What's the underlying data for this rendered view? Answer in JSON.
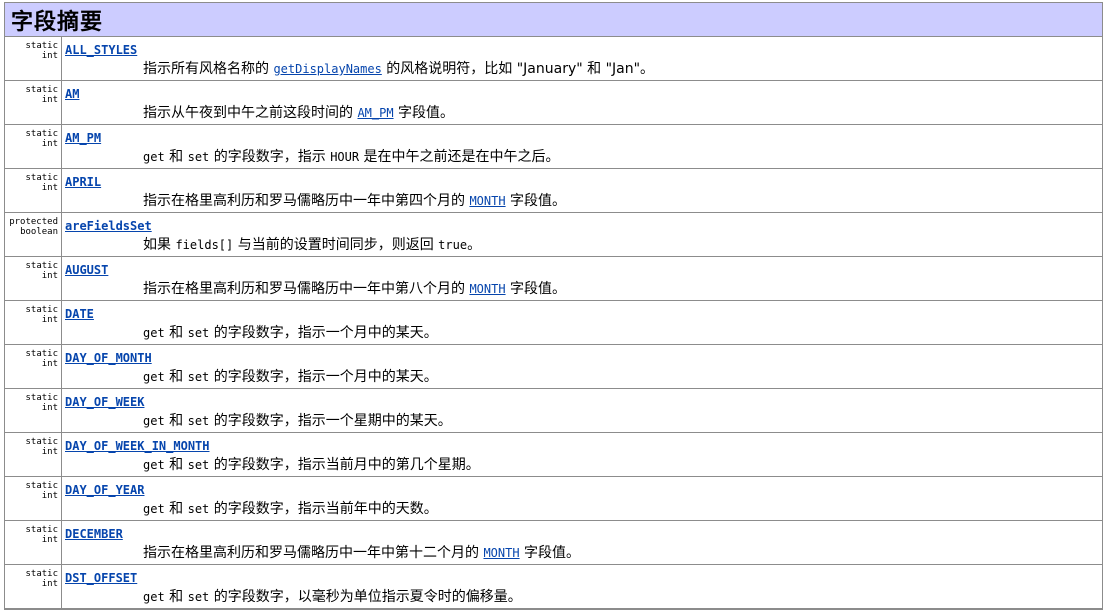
{
  "header": {
    "title": "字段摘要"
  },
  "rows": [
    {
      "modifier": "static int",
      "name": "ALL_STYLES",
      "d1": "指示所有风格名称的 ",
      "d_link": "getDisplayNames",
      "d2": " 的风格说明符，比如 \"January\" 和 \"Jan\"。"
    },
    {
      "modifier": "static int",
      "name": "AM",
      "d1": "指示从午夜到中午之前这段时间的 ",
      "d_link": "AM_PM",
      "d2": " 字段值。"
    },
    {
      "modifier": "static int",
      "name": "AM_PM",
      "c1": "get",
      "t1": " 和 ",
      "c2": "set",
      "t2": " 的字段数字，指示 ",
      "c3": "HOUR",
      "t3": " 是在中午之前还是在中午之后。"
    },
    {
      "modifier": "static int",
      "name": "APRIL",
      "d1": "指示在格里高利历和罗马儒略历中一年中第四个月的 ",
      "d_link": "MONTH",
      "d2": " 字段值。"
    },
    {
      "modifier1": "protected",
      "modifier2": "boolean",
      "name": "areFieldsSet",
      "t1": "如果 ",
      "c1": "fields[]",
      "t2": " 与当前的设置时间同步，则返回 ",
      "c2": "true",
      "t3": "。"
    },
    {
      "modifier": "static int",
      "name": "AUGUST",
      "d1": "指示在格里高利历和罗马儒略历中一年中第八个月的 ",
      "d_link": "MONTH",
      "d2": " 字段值。"
    },
    {
      "modifier": "static int",
      "name": "DATE",
      "c1": "get",
      "t1": " 和 ",
      "c2": "set",
      "t2": " 的字段数字，指示一个月中的某天。"
    },
    {
      "modifier": "static int",
      "name": "DAY_OF_MONTH",
      "c1": "get",
      "t1": " 和 ",
      "c2": "set",
      "t2": " 的字段数字，指示一个月中的某天。"
    },
    {
      "modifier": "static int",
      "name": "DAY_OF_WEEK",
      "c1": "get",
      "t1": " 和 ",
      "c2": "set",
      "t2": " 的字段数字，指示一个星期中的某天。"
    },
    {
      "modifier": "static int",
      "name": "DAY_OF_WEEK_IN_MONTH",
      "c1": "get",
      "t1": " 和 ",
      "c2": "set",
      "t2": " 的字段数字，指示当前月中的第几个星期。"
    },
    {
      "modifier": "static int",
      "name": "DAY_OF_YEAR",
      "c1": "get",
      "t1": " 和 ",
      "c2": "set",
      "t2": " 的字段数字，指示当前年中的天数。"
    },
    {
      "modifier": "static int",
      "name": "DECEMBER",
      "d1": "指示在格里高利历和罗马儒略历中一年中第十二个月的 ",
      "d_link": "MONTH",
      "d2": " 字段值。"
    },
    {
      "modifier": "static int",
      "name": "DST_OFFSET",
      "c1": "get",
      "t1": " 和 ",
      "c2": "set",
      "t2": " 的字段数字，以毫秒为单位指示夏令时的偏移量。"
    }
  ]
}
